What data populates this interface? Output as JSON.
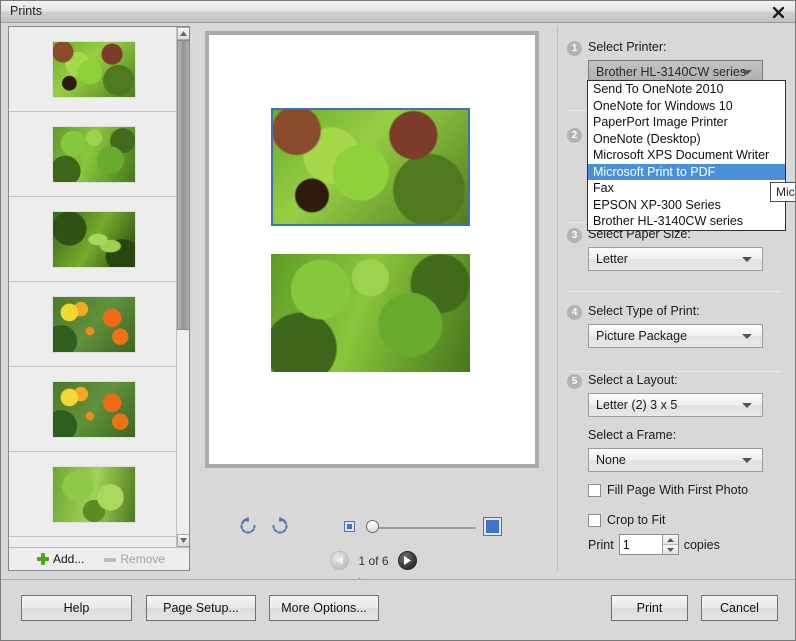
{
  "window": {
    "title": "Prints",
    "close_icon": "close-icon"
  },
  "sidebar": {
    "thumbnails": [
      {
        "alt": "lettuce-plants"
      },
      {
        "alt": "potato-plants"
      },
      {
        "alt": "pea-pods"
      },
      {
        "alt": "marigold-flowers"
      },
      {
        "alt": "marigold-flowers"
      },
      {
        "alt": "green-leaves"
      }
    ],
    "add_label": "Add...",
    "remove_label": "Remove"
  },
  "preview": {
    "rotate_ccw_icon": "rotate-counter-clockwise-icon",
    "rotate_cw_icon": "rotate-clockwise-icon",
    "zoom_out_icon": "zoom-small-icon",
    "zoom_in_icon": "zoom-large-icon",
    "page_count_label": "1 of 6",
    "paper_label": "Letter",
    "photos": [
      {
        "alt": "lettuce-plants",
        "selected": true
      },
      {
        "alt": "potato-plants",
        "selected": false
      }
    ]
  },
  "settings": {
    "step1": {
      "number": "1",
      "label": "Select Printer:",
      "value": "Brother HL-3140CW series",
      "open": true,
      "options": [
        "Send To OneNote 2010",
        "OneNote for Windows 10",
        "PaperPort Image Printer",
        "OneNote (Desktop)",
        "Microsoft XPS Document Writer",
        "Microsoft Print to PDF",
        "Fax",
        "EPSON XP-300 Series",
        "Brother HL-3140CW series"
      ],
      "highlighted_option": "Microsoft Print to PDF",
      "tooltip": "Mic"
    },
    "step2": {
      "number": "2"
    },
    "step3": {
      "number": "3",
      "label": "Select Paper Size:",
      "value": "Letter"
    },
    "step4": {
      "number": "4",
      "label": "Select Type of Print:",
      "value": "Picture Package"
    },
    "step5": {
      "number": "5",
      "label": "Select a Layout:",
      "value": "Letter (2) 3 x 5",
      "frame_label": "Select a Frame:",
      "frame_value": "None",
      "fill_page_label": "Fill Page With First Photo",
      "fill_page_checked": false,
      "crop_to_fit_label": "Crop to Fit",
      "crop_to_fit_checked": false
    },
    "copies": {
      "prefix": "Print",
      "value": "1",
      "suffix": "copies"
    }
  },
  "buttons": {
    "help": "Help",
    "page_setup": "Page Setup...",
    "more_options": "More Options...",
    "print": "Print",
    "cancel": "Cancel"
  },
  "colors": {
    "selection_blue": "#4a90d9",
    "photo_border_blue": "#3f72a8",
    "add_green": "#4aa714",
    "rotate_icon_blue": "#4a76a8"
  }
}
